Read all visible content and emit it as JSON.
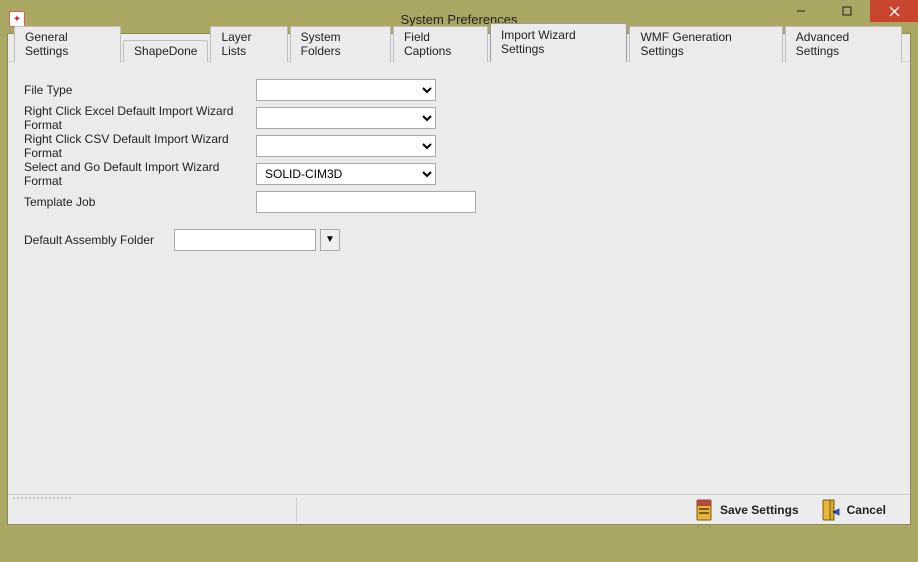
{
  "window": {
    "title": "System Preferences"
  },
  "tabs": [
    {
      "label": "General Settings"
    },
    {
      "label": "ShapeDone"
    },
    {
      "label": "Layer Lists"
    },
    {
      "label": "System Folders"
    },
    {
      "label": "Field Captions"
    },
    {
      "label": "Import Wizard Settings"
    },
    {
      "label": "WMF Generation Settings"
    },
    {
      "label": "Advanced Settings"
    }
  ],
  "active_tab_index": 5,
  "form": {
    "file_type": {
      "label": "File Type",
      "value": ""
    },
    "right_click_excel": {
      "label": "Right Click Excel Default Import Wizard Format",
      "value": ""
    },
    "right_click_csv": {
      "label": "Right Click CSV Default Import Wizard Format",
      "value": ""
    },
    "select_and_go": {
      "label": "Select and Go Default Import Wizard Format",
      "value": "SOLID-CIM3D"
    },
    "template_job": {
      "label": "Template Job",
      "value": ""
    },
    "default_assembly_folder": {
      "label": "Default Assembly Folder",
      "value": ""
    }
  },
  "footer": {
    "save": "Save Settings",
    "cancel": "Cancel"
  }
}
